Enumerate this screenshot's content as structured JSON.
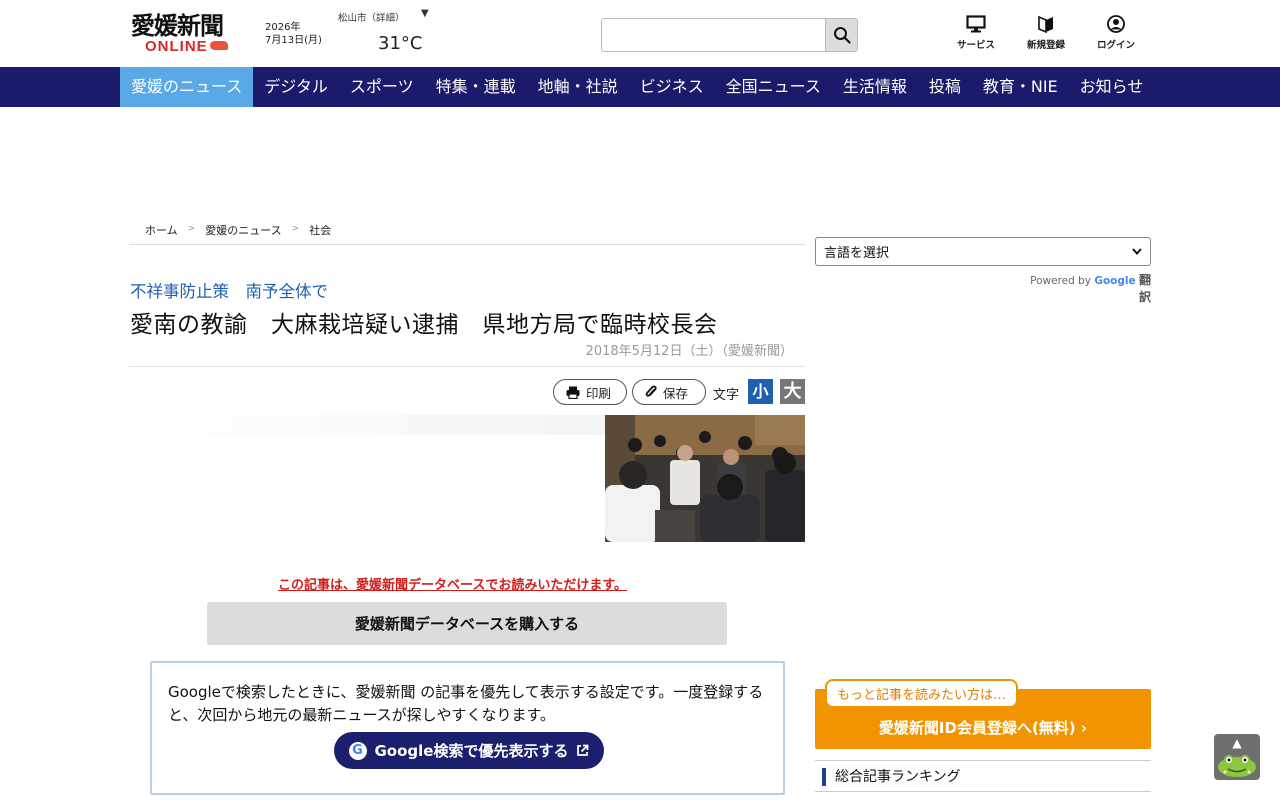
{
  "header": {
    "logo_main": "愛媛新聞",
    "logo_sub": "ONLINE",
    "date_year": "2026年",
    "date_day": "7月13日(月)",
    "weather_location": "松山市（詳細）",
    "temperature": "31°C",
    "search_placeholder": "",
    "icons": [
      {
        "name": "monitor-icon",
        "label": "サービス"
      },
      {
        "name": "beginner-mark-icon",
        "label": "新規登録"
      },
      {
        "name": "user-icon",
        "label": "ログイン"
      }
    ]
  },
  "nav": {
    "items": [
      "愛媛のニュース",
      "デジタル",
      "スポーツ",
      "特集・連載",
      "地軸・社説",
      "ビジネス",
      "全国ニュース",
      "生活情報",
      "投稿",
      "教育・NIE",
      "お知らせ"
    ],
    "active_index": 0
  },
  "breadcrumb": [
    "ホーム",
    "愛媛のニュース",
    "社会"
  ],
  "breadcrumb_separator": ">",
  "article": {
    "subtitle": "不祥事防止策　南予全体で",
    "title": "愛南の教諭　大麻栽培疑い逮捕　県地方局で臨時校長会",
    "meta": "2018年5月12日（土）（愛媛新聞）",
    "print_label": "印刷",
    "save_label": "保存",
    "font_label": "文字",
    "font_small": "小",
    "font_large": "大",
    "paywall_notice": "この記事は、愛媛新聞データベースでお読みいただけます。",
    "buy_label": "愛媛新聞データベースを購入する"
  },
  "google_box": {
    "text": "Googleで検索したときに、愛媛新聞 の記事を優先して表示する設定です。一度登録すると、次回から地元の最新ニュースが探しやすくなります。",
    "button_label": "Google検索で優先表示する"
  },
  "sidebar": {
    "language_select": "言語を選択",
    "powered_by": "Powered by",
    "google_word": "Google",
    "translate_word": "翻訳",
    "member_bubble": "もっと記事を読みたい方は…",
    "member_cta": "愛媛新聞ID会員登録へ(無料)",
    "ranking_title": "総合記事ランキング"
  },
  "colors": {
    "nav_bg": "#1b1a6b",
    "nav_active": "#5aa9e6",
    "accent_orange": "#f29400",
    "notice_red": "#d21d1d",
    "subtitle_blue": "#1f5fb0"
  }
}
